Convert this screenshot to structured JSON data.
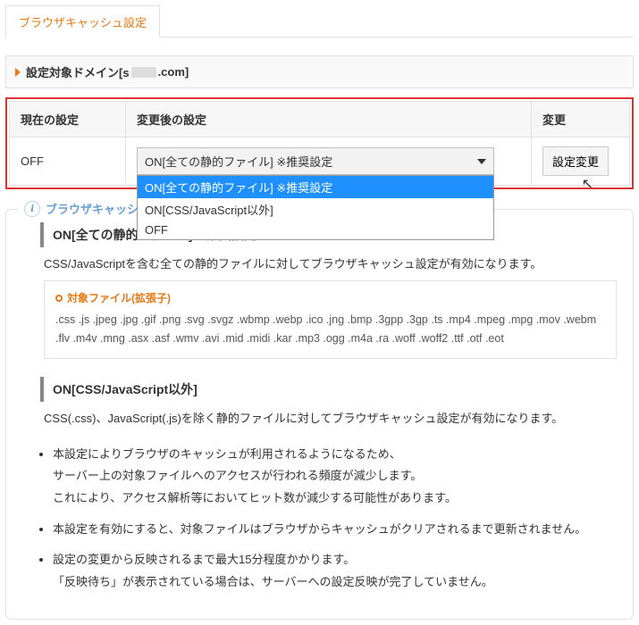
{
  "tab_label": "ブラウザキャッシュ設定",
  "section_title_prefix": "設定対象ドメイン[s",
  "section_title_suffix": ".com]",
  "table": {
    "header_current": "現在の設定",
    "header_after": "変更後の設定",
    "header_change": "変更",
    "current_value": "OFF",
    "select_display": "ON[全ての静的ファイル] ※推奨設定",
    "options": [
      "ON[全ての静的ファイル] ※推奨設定",
      "ON[CSS/JavaScript以外]",
      "OFF"
    ],
    "change_button": "設定変更"
  },
  "info": {
    "title": "ブラウザキャッシュ設定について",
    "title_visible": "ブラウザキャッシ",
    "block1": {
      "heading": "ON[全ての静的ファイル] ※推奨設定",
      "desc": "CSS/JavaScriptを含む全ての静的ファイルに対してブラウザキャッシュ設定が有効になります。",
      "ext_title": "対象ファイル(拡張子)",
      "ext_list": ".css .js .jpeg .jpg .gif .png .svg .svgz .wbmp .webp .ico .jng .bmp .3gpp .3gp .ts .mp4 .mpeg .mpg .mov .webm .flv .m4v .mng .asx .asf .wmv .avi .mid .midi .kar .mp3 .ogg .m4a .ra .woff .woff2 .ttf .otf .eot"
    },
    "block2": {
      "heading": "ON[CSS/JavaScript以外]",
      "desc": "CSS(.css)、JavaScript(.js)を除く静的ファイルに対してブラウザキャッシュ設定が有効になります。"
    },
    "notes": [
      "本設定によりブラウザのキャッシュが利用されるようになるため、\nサーバー上の対象ファイルへのアクセスが行われる頻度が減少します。\nこれにより、アクセス解析等においてヒット数が減少する可能性があります。",
      "本設定を有効にすると、対象ファイルはブラウザからキャッシュがクリアされるまで更新されません。",
      "設定の変更から反映されるまで最大15分程度かかります。\n「反映待ち」が表示されている場合は、サーバーへの設定反映が完了していません。"
    ]
  }
}
